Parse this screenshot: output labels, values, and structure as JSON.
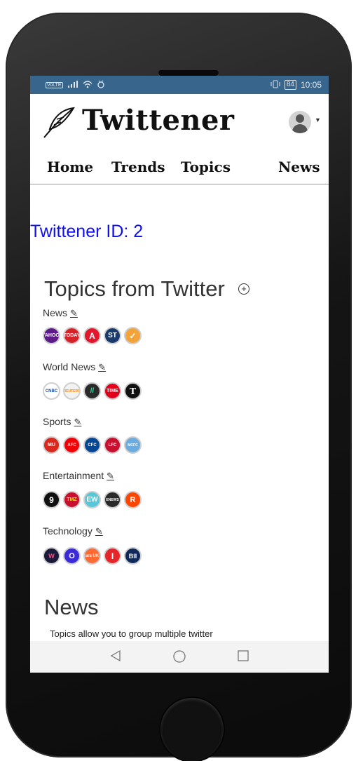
{
  "status_bar": {
    "carrier_icon": "carrier-badge-icon",
    "carrier_text": "VoLTE",
    "signal_icon": "signal-bars-icon",
    "wifi_icon": "wifi-icon",
    "notification_icon": "app-notification-icon",
    "vibrate_icon": "vibrate-icon",
    "battery_level": "84",
    "time": "10:05"
  },
  "app": {
    "title": "Twittener",
    "logo_icon": "feather-icon"
  },
  "nav": {
    "items": [
      {
        "label": "Home"
      },
      {
        "label": "Trends"
      },
      {
        "label": "Topics"
      },
      {
        "label": "News"
      }
    ]
  },
  "twittener_id_label": "Twittener ID: 2",
  "topics": {
    "title": "Topics from Twitter",
    "add_icon": "plus-circle-icon",
    "edit_icon": "pencil-icon",
    "categories": [
      {
        "name": "News",
        "accounts": [
          {
            "label": "YAHOO!",
            "color": "#5c1a8b"
          },
          {
            "label": "TODAY",
            "color": "#d4242a"
          },
          {
            "label": "A",
            "color": "#e4162b"
          },
          {
            "label": "ST",
            "color": "#1a3a6c"
          },
          {
            "label": "✓",
            "color": "#f2a33a"
          }
        ]
      },
      {
        "name": "World News",
        "accounts": [
          {
            "label": "CNBC",
            "color": "#ffffff"
          },
          {
            "label": "REUTERS",
            "color": "#f2f2f2"
          },
          {
            "label": "//",
            "color": "#2a2a2a"
          },
          {
            "label": "TIME",
            "color": "#e3001b"
          },
          {
            "label": "T",
            "color": "#111111"
          }
        ]
      },
      {
        "name": "Sports",
        "accounts": [
          {
            "label": "MU",
            "color": "#da291c"
          },
          {
            "label": "AFC",
            "color": "#ef0107"
          },
          {
            "label": "CFC",
            "color": "#034694"
          },
          {
            "label": "LFC",
            "color": "#c8102e"
          },
          {
            "label": "MCFC",
            "color": "#6cabdd"
          }
        ]
      },
      {
        "name": "Entertainment",
        "accounts": [
          {
            "label": "9",
            "color": "#111111"
          },
          {
            "label": "TMZ",
            "color": "#c8102e"
          },
          {
            "label": "EW",
            "color": "#56c7d8"
          },
          {
            "label": "ENEWS",
            "color": "#2a2a2a"
          },
          {
            "label": "R",
            "color": "#ff4500"
          }
        ]
      },
      {
        "name": "Technology",
        "accounts": [
          {
            "label": "W",
            "color": "#1a1a3a"
          },
          {
            "label": "O",
            "color": "#3a2ad8"
          },
          {
            "label": "ars UK",
            "color": "#ff6a33"
          },
          {
            "label": "I",
            "color": "#e4262b"
          },
          {
            "label": "BII",
            "color": "#0f2a5a"
          }
        ]
      }
    ]
  },
  "news": {
    "title": "News",
    "description": "Topics allow you to group multiple twitter"
  },
  "android_nav": {
    "back_icon": "back-triangle-icon",
    "home_icon": "home-circle-icon",
    "recents_icon": "recents-square-icon"
  }
}
